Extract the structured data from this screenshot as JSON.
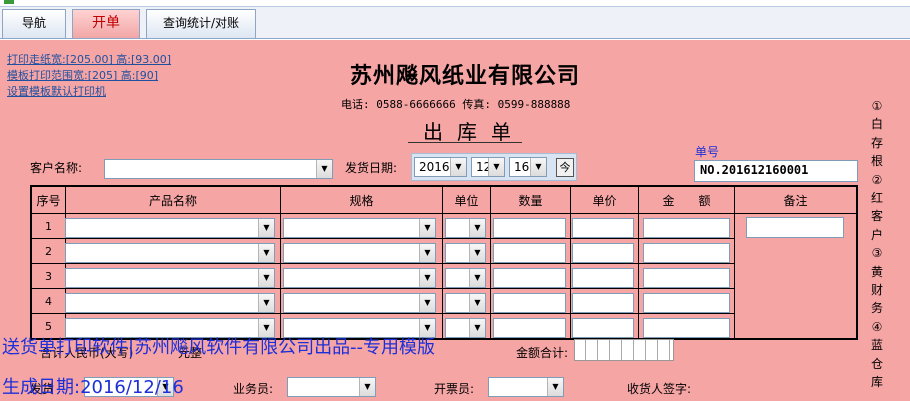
{
  "tabs": [
    "导航",
    "开单",
    "查询统计/对账"
  ],
  "print_links": {
    "paper_size": "打印走纸宽:[205.00] 高:[93.00]",
    "template_range": "模板打印范围宽:[205] 高:[90]",
    "default_printer": "设置模板默认打印机"
  },
  "company": {
    "name": "苏州飚风纸业有限公司",
    "contact": "电话: 0588-6666666  传真: 0599-888888"
  },
  "doc_title": "出库单",
  "order": {
    "label": "单号",
    "number": "NO.201612160001"
  },
  "customer": {
    "label": "客户名称:",
    "value": ""
  },
  "ship_date": {
    "label": "发货日期:",
    "year": "2016",
    "month": "12",
    "day": "16",
    "today_button": "今"
  },
  "table": {
    "headers": [
      "序号",
      "产品名称",
      "规格",
      "单位",
      "数量",
      "单价",
      "金　　额",
      "备注"
    ],
    "rows": [
      "1",
      "2",
      "3",
      "4",
      "5"
    ]
  },
  "footer": {
    "total_rmb_label": "合计人民币(大写)",
    "yuan_label": "元整",
    "amount_total_label": "金额合计:",
    "salesperson_label": "业务员:",
    "invoicer_label": "开票员:",
    "receiver_label": "收货人签字:",
    "ship_label_partial": "发货"
  },
  "side_labels": [
    "①",
    "白",
    "存",
    "根",
    "②",
    "红",
    "客",
    "户",
    "③",
    "黄",
    "财",
    "务",
    "④",
    "蓝",
    "仓",
    "库"
  ],
  "overlay": {
    "line1": "送货单打印软件|苏州飚风软件有限公司出品--专用模版",
    "line2": "生成日期:2016/12/16"
  },
  "colors": {
    "page_bg": "#f6a5a5",
    "link": "#2050a0",
    "overlay_text": "#1d2fd8",
    "active_tab": "#c00000"
  }
}
